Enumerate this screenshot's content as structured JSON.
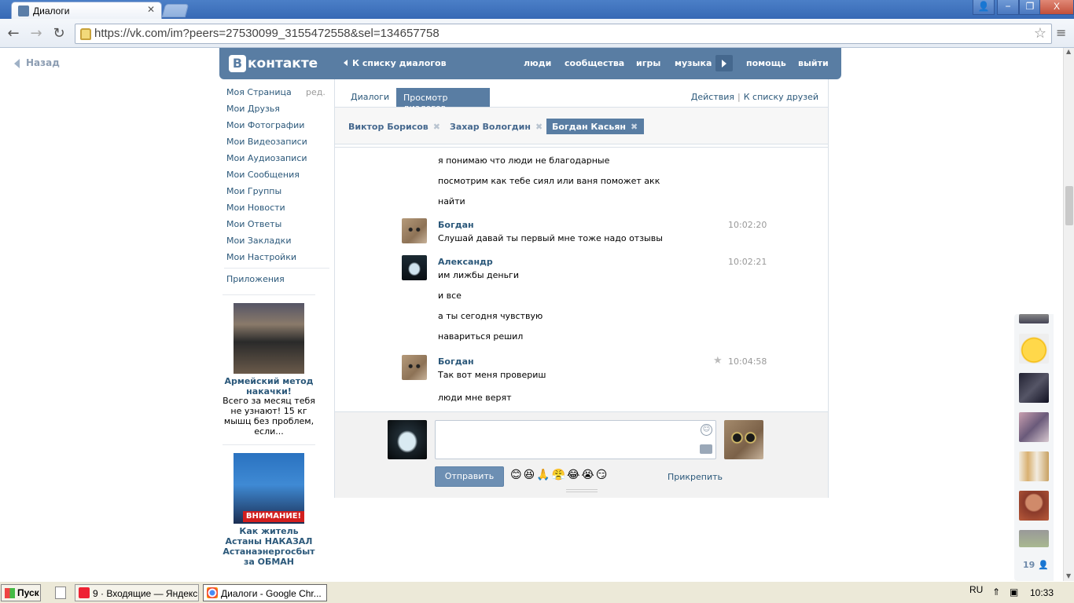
{
  "browser": {
    "tab_title": "Диалоги",
    "url": "https://vk.com/im?peers=27530099_3155472558&sel=134657758",
    "window_buttons": [
      "−",
      "❐",
      "X"
    ]
  },
  "page": {
    "back_label": "Назад",
    "logo_text": "контакте",
    "logo_letter": "В",
    "header_back": "К списку диалогов",
    "nav": [
      "люди",
      "сообщества",
      "игры",
      "музыка",
      "помощь",
      "выйти"
    ],
    "left_menu": [
      "Моя Страница",
      "Мои Друзья",
      "Мои Фотографии",
      "Мои Видеозаписи",
      "Мои Аудиозаписи",
      "Мои Сообщения",
      "Мои Группы",
      "Мои Новости",
      "Мои Ответы",
      "Мои Закладки",
      "Мои Настройки"
    ],
    "edit_label": "ред.",
    "apps_label": "Приложения",
    "ads": [
      {
        "title": "Армейский метод накачки!",
        "text": "Всего за месяц тебя не узнают! 15 кг мышц без проблем, если..."
      },
      {
        "title": "Как житель Астаны НАКАЗАЛ Астанаэнергосбыт за ОБМАН",
        "badge": "ВНИМАНИЕ!"
      }
    ],
    "tabs": {
      "dialogs": "Диалоги",
      "view": "Просмотр диалогов",
      "actions": "Действия",
      "friends_list": "К списку друзей"
    },
    "peers": [
      "Виктор Борисов",
      "Захар Вологдин",
      "Богдан Касьян"
    ],
    "messages": [
      {
        "text": "я понимаю что люди не благодарные"
      },
      {
        "text": "посмотрим как тебе сиял или ваня поможет акк"
      },
      {
        "text": "найти"
      },
      {
        "name": "Богдан",
        "time": "10:02:20",
        "text": "Слушай давай ты первый мне тоже надо отзывы"
      },
      {
        "name": "Александр",
        "time": "10:02:21",
        "text": "им лижбы деньги"
      },
      {
        "text": "и все"
      },
      {
        "text": "а ты сегодня чувствую"
      },
      {
        "text": "навариться решил"
      },
      {
        "name": "Богдан",
        "time": "10:04:58",
        "text": "Так вот меня провериш"
      },
      {
        "text": "люди мне верят"
      }
    ],
    "compose": {
      "send": "Отправить",
      "attach": "Прикрепить",
      "emojis": "😊😆🙏😤😂😭😏"
    },
    "online_count": "19"
  },
  "taskbar": {
    "start": "Пуск",
    "items": [
      "9 · Входящие — Яндекс...",
      "Диалоги - Google Chr..."
    ],
    "lang": "RU",
    "time": "10:33"
  }
}
